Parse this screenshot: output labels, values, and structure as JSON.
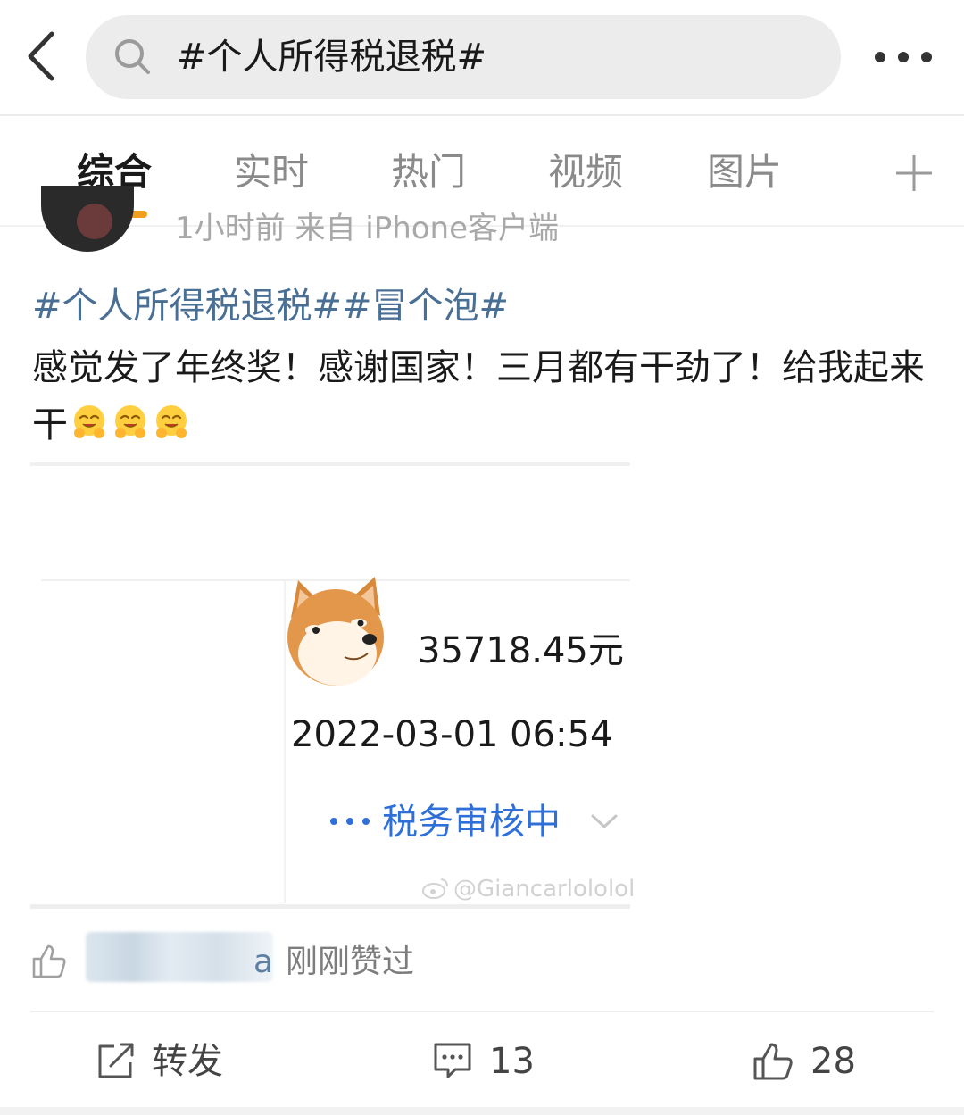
{
  "search": {
    "query": "#个人所得税退税#"
  },
  "tabs": [
    {
      "label": "综合",
      "active": true
    },
    {
      "label": "实时"
    },
    {
      "label": "热门"
    },
    {
      "label": "视频"
    },
    {
      "label": "图片"
    }
  ],
  "post": {
    "meta": "1小时前 来自 iPhone客户端",
    "hashtags": "#个人所得税退税##冒个泡#",
    "text": "感觉发了年终奖！感谢国家！三月都有干劲了！给我起来干",
    "emojis": [
      "hug-emoji",
      "hug-emoji",
      "hug-emoji"
    ],
    "image": {
      "amount": "35718.45元",
      "datetime": "2022-03-01 06:54",
      "status": "税务审核中",
      "watermark": "@Giancarlololol"
    }
  },
  "likes": {
    "name_suffix": "a",
    "text": "刚刚赞过"
  },
  "actions": {
    "repost_label": "转发",
    "comment_count": "13",
    "like_count": "28"
  },
  "colors": {
    "accent": "#f0a01c",
    "hashtag": "#4a6f95",
    "status_blue": "#2f6fd8",
    "text": "#1a1a1a",
    "muted": "#8a8a8a"
  }
}
